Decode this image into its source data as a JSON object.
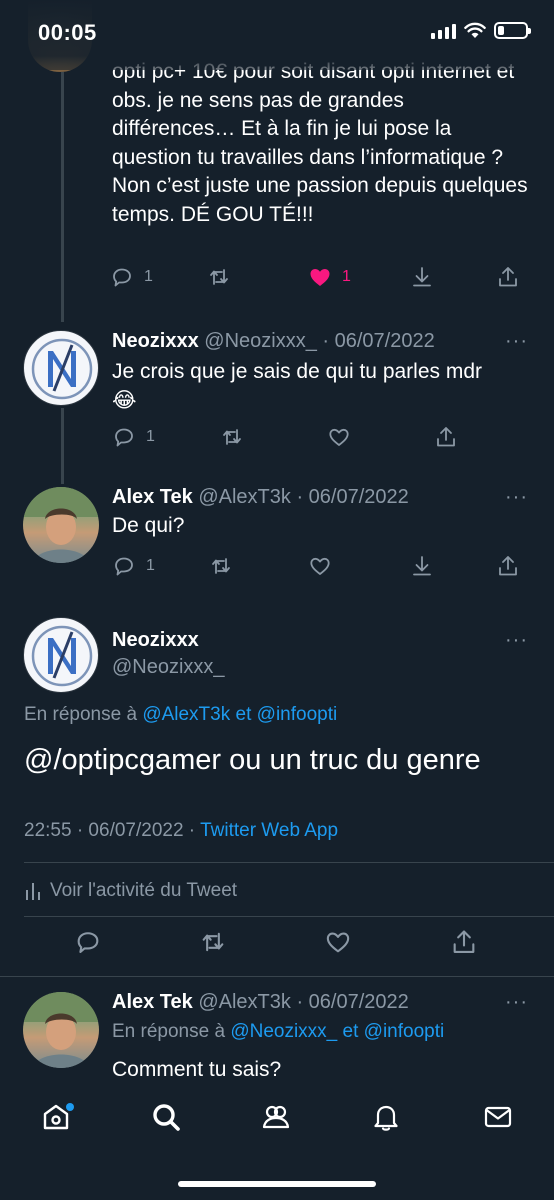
{
  "status_bar": {
    "time": "00:05"
  },
  "tweets": [
    {
      "text": "opti pc+ 10€ pour soit disant opti internet et obs. je ne sens pas de grandes différences… Et à la fin je lui pose la question tu travailles dans l’informatique ? Non c’est juste une passion depuis quelques temps. DÉ GOU TÉ!!!",
      "reply_count": "1",
      "like_count": "1"
    },
    {
      "name": "Neozixxx",
      "meta": "@Neozixxx_ · 06/07/2022",
      "text": "Je crois que je sais de qui tu parles mdr 😂",
      "reply_count": "1"
    },
    {
      "name": "Alex Tek",
      "meta": "@AlexT3k · 06/07/2022",
      "text": "De qui?",
      "reply_count": "1"
    }
  ],
  "focused_tweet": {
    "name": "Neozixxx",
    "handle": "@Neozixxx_",
    "reply_prefix": "En réponse à",
    "reply_user1": "@AlexT3k",
    "reply_sep": "et",
    "reply_user2": "@infoopti",
    "text": "@/optipcgamer ou un truc du genre",
    "time_date": "22:55 · 06/07/2022 ·",
    "source": "Twitter Web App",
    "activity": "Voir l'activité du Tweet"
  },
  "bottom_reply": {
    "name": "Alex Tek",
    "meta": "@AlexT3k · 06/07/2022",
    "reply_prefix": "En réponse à",
    "reply_user1": "@Neozixxx_",
    "reply_sep": "et",
    "reply_user2": "@infoopti",
    "text": "Comment tu sais?"
  },
  "more_label": "···",
  "colors": {
    "background": "#15202b",
    "accent": "#1d9bf0",
    "like": "#f91880",
    "muted": "#8b98a5"
  },
  "nav": {
    "items": [
      "home-icon",
      "search-icon",
      "communities-icon",
      "notifications-icon",
      "messages-icon"
    ]
  }
}
